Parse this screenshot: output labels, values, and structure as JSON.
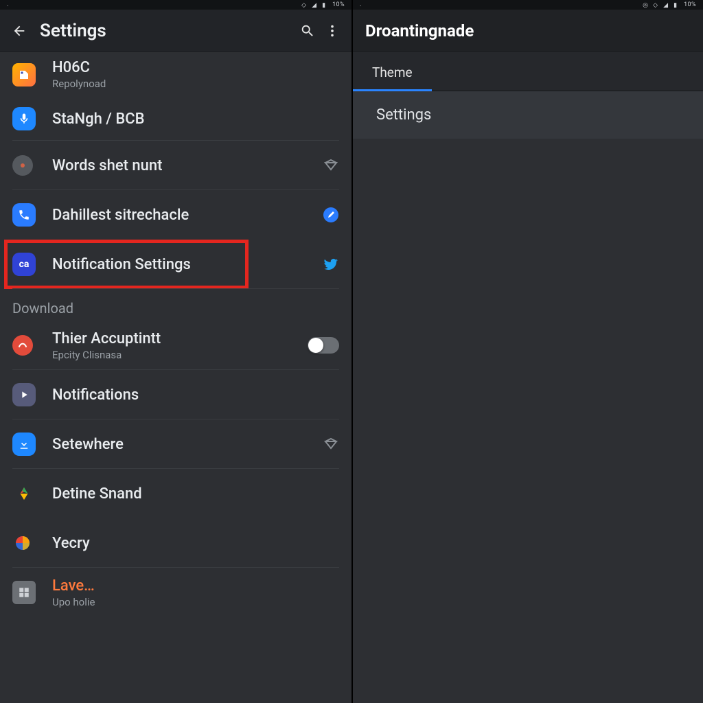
{
  "statusbar": {
    "right_text": "10%"
  },
  "left": {
    "title": "Settings",
    "items": [
      {
        "label": "H06C",
        "sub": "Repolynoad"
      },
      {
        "label": "StaNgh / BCB"
      },
      {
        "label": "Words shet nunt"
      },
      {
        "label": "Dahillest sitrechacle"
      },
      {
        "label": "Notification Settings"
      }
    ],
    "section": "Download",
    "items2": [
      {
        "label": "Thier Accuptintt",
        "sub": "Epcity Clisnasa"
      },
      {
        "label": "Notifications"
      },
      {
        "label": "Setewhere"
      },
      {
        "label": "Detine Snand"
      },
      {
        "label": "Yecry"
      },
      {
        "label": "Lave…",
        "sub": "Upo holie"
      }
    ]
  },
  "right": {
    "title": "Droantingnade",
    "tab": "Theme",
    "menuitem": "Settings"
  }
}
